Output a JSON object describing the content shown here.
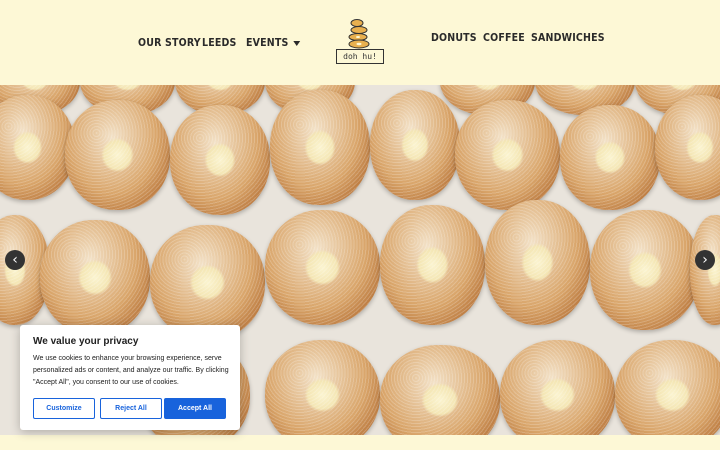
{
  "nav": {
    "left": [
      "OUR STORY",
      "LEEDS",
      "EVENTS"
    ],
    "right": [
      "DONUTS",
      "COFFEE",
      "SANDWICHES"
    ]
  },
  "logo": {
    "text": "doh hu!"
  },
  "hero": {
    "prev_icon": "chevron-left-icon",
    "next_icon": "chevron-right-icon",
    "prev_glyph": "‹",
    "next_glyph": "›"
  },
  "cookie_banner": {
    "title": "We value your privacy",
    "body": "We use cookies to enhance your browsing experience, serve personalized ads or content, and analyze our traffic. By clicking \"Accept All\", you consent to our use of cookies.",
    "customize_label": "Customize",
    "reject_label": "Reject All",
    "accept_label": "Accept All"
  },
  "colors": {
    "background": "#fdf8d6",
    "accent": "#1863dc",
    "nav_text": "#2a2a2a"
  }
}
